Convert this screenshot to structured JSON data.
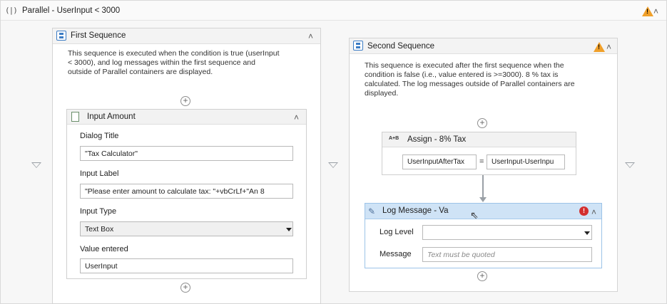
{
  "parallel": {
    "title": "Parallel - UserInput < 3000"
  },
  "first_sequence": {
    "title": "First Sequence",
    "description_lines": [
      "This sequence is executed when the condition is true (userInput",
      "< 3000), and log messages within the first sequence and",
      "outside of Parallel containers are displayed."
    ],
    "input_amount": {
      "title": "Input Amount",
      "dialog_title_label": "Dialog Title",
      "dialog_title_value": "\"Tax Calculator\"",
      "input_label_label": "Input Label",
      "input_label_value": "\"Please enter amount to calculate tax: \"+vbCrLf+\"An 8",
      "input_type_label": "Input Type",
      "input_type_value": "Text Box",
      "value_entered_label": "Value entered",
      "value_entered_value": "UserInput"
    }
  },
  "second_sequence": {
    "title": "Second Sequence",
    "description_lines": [
      "This sequence is executed after the first sequence when the",
      "condition is false (i.e., value entered is >=3000). 8 % tax is",
      "calculated. The log messages outside of Parallel containers are",
      "displayed."
    ],
    "assign": {
      "icon_text": "A+B",
      "title": "Assign - 8% Tax",
      "to_value": "UserInputAfterTax",
      "equals": "=",
      "value": "UserInput-UserInpu"
    },
    "log_message": {
      "title": "Log Message - Va",
      "error_mark": "!",
      "log_level_label": "Log Level",
      "log_level_value": "",
      "message_label": "Message",
      "message_placeholder": "Text must be quoted"
    }
  },
  "icons": {
    "collapse": "double-chevron-up-icon",
    "warning": "warning-icon",
    "add": "plus-circle-icon",
    "drop_target": "triangle-down-icon"
  },
  "colors": {
    "selected_header": "#cfe3f6",
    "error": "#d32f2f",
    "warning": "#f0a02a",
    "sequence_icon": "#3b7cc4"
  }
}
